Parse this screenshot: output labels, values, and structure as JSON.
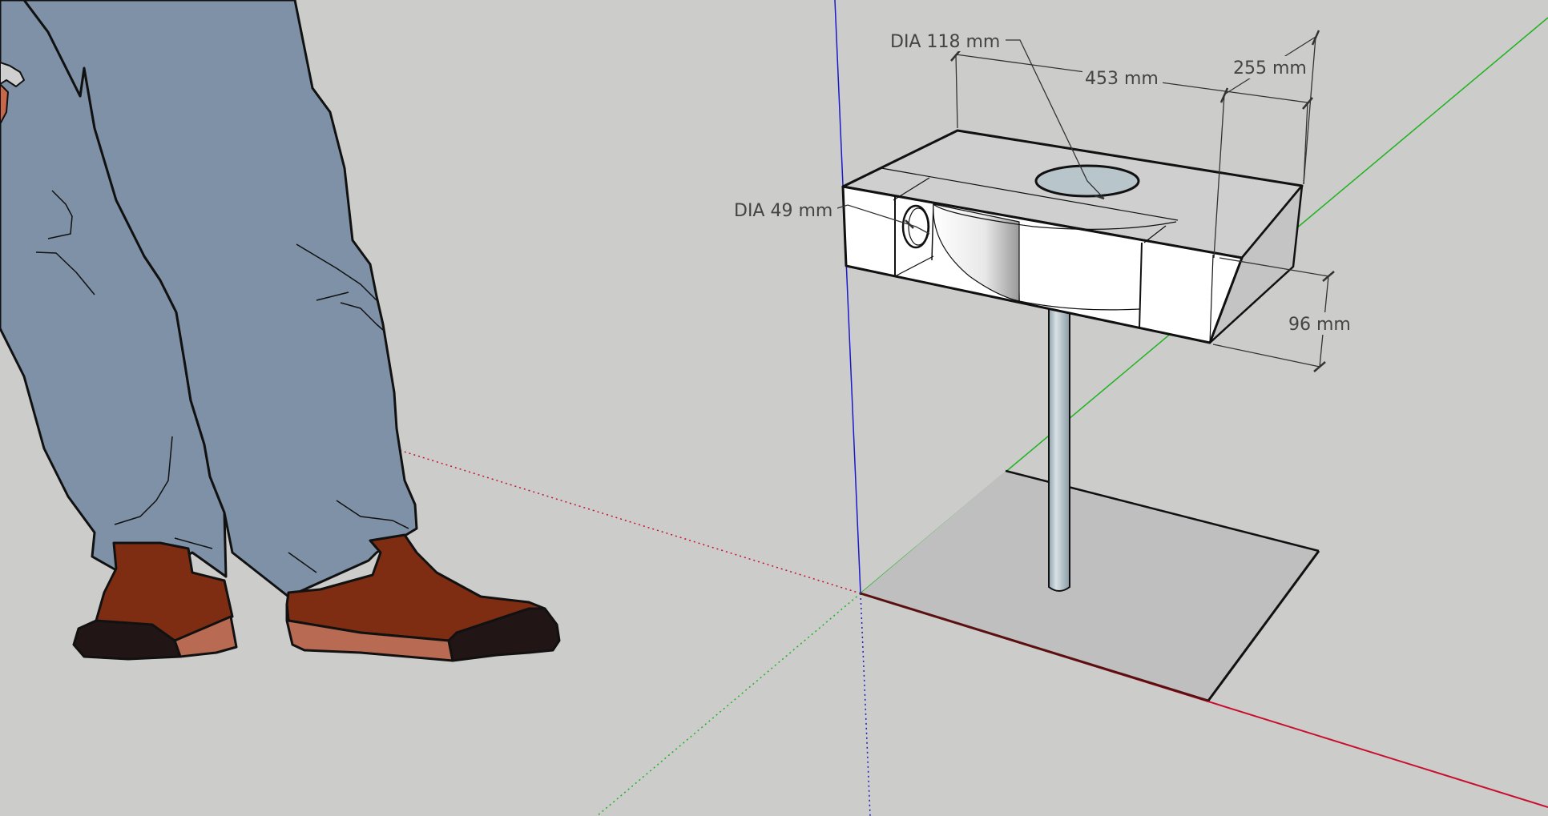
{
  "viewport": {
    "background": "#cccccb"
  },
  "axes": {
    "red": "#c8102e",
    "green": "#1fb31f",
    "blue": "#1a1ac8"
  },
  "dimensions": {
    "dia_top": "DIA 118 mm",
    "length": "453 mm",
    "width": "255 mm",
    "dia_side": "DIA 49 mm",
    "height": "96 mm"
  },
  "figure": {
    "name": "scale-figure",
    "pants_color": "#7f91a6",
    "shoe_color": "#7f2d12",
    "shoe_sole_color": "#b86b52",
    "shoe_toe_color": "#221515"
  },
  "model": {
    "box_face_color": "#ffffff",
    "box_top_color": "#cfcfcf",
    "box_side_color": "#c4c4c4",
    "base_plate_color": "#bfbfbf",
    "pole_color": "#b8c6cc"
  }
}
